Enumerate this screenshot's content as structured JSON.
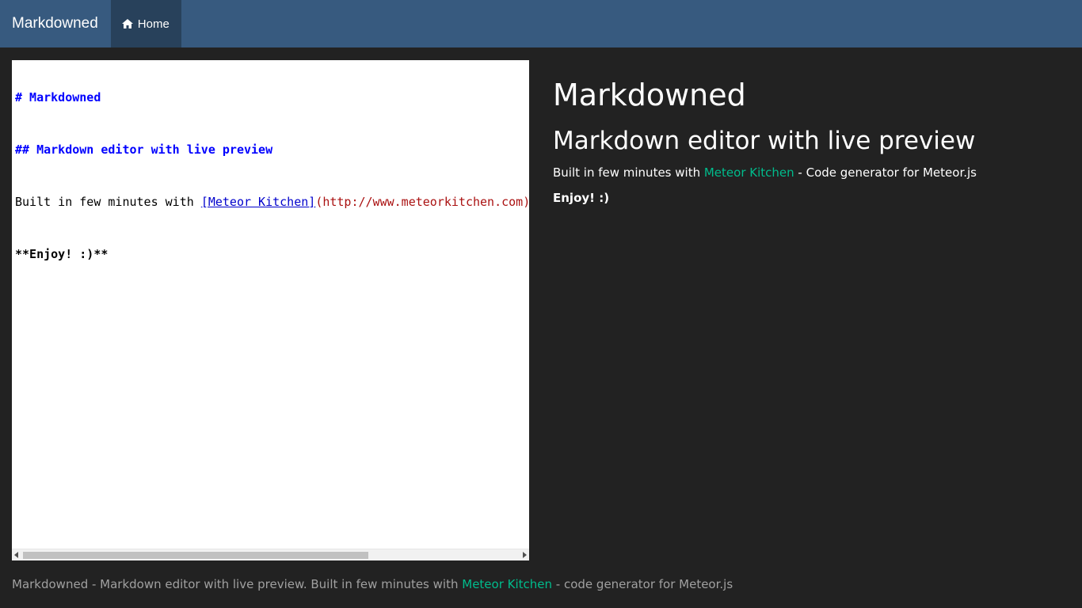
{
  "navbar": {
    "brand": "Markdowned",
    "home_label": "Home",
    "home_icon": "home-icon"
  },
  "editor": {
    "line1": "# Markdowned",
    "line2": "## Markdown editor with live preview",
    "line3_text": "Built in few minutes with ",
    "line3_link": "[Meteor Kitchen]",
    "line3_url": "(http://www.meteorkitchen.com)",
    "line4": "**Enjoy! :)**"
  },
  "preview": {
    "h1": "Markdowned",
    "h2": "Markdown editor with live preview",
    "p_before": "Built in few minutes with ",
    "p_link": "Meteor Kitchen",
    "p_after": " - Code generator for Meteor.js",
    "enjoy": "Enjoy! :)"
  },
  "footer": {
    "before": "Markdowned - Markdown editor with live preview. Built in few minutes with ",
    "link": "Meteor Kitchen",
    "after": " - code generator for Meteor.js"
  },
  "colors": {
    "navbar": "#375a7f",
    "nav_active": "#28415b",
    "background": "#222222",
    "accent_link": "#00bc8c"
  }
}
